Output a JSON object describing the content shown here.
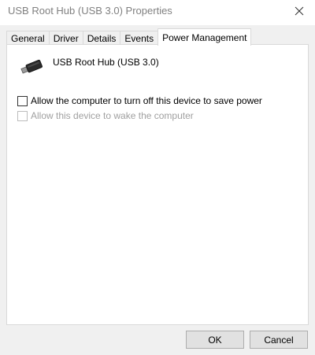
{
  "window": {
    "title": "USB Root Hub (USB 3.0) Properties"
  },
  "tabs": [
    {
      "label": "General",
      "active": false
    },
    {
      "label": "Driver",
      "active": false
    },
    {
      "label": "Details",
      "active": false
    },
    {
      "label": "Events",
      "active": false
    },
    {
      "label": "Power Management",
      "active": true
    }
  ],
  "device": {
    "name": "USB Root Hub (USB 3.0)",
    "icon": "usb-plug-icon"
  },
  "options": [
    {
      "label": "Allow the computer to turn off this device to save power",
      "checked": false,
      "enabled": true
    },
    {
      "label": "Allow this device to wake the computer",
      "checked": false,
      "enabled": false
    }
  ],
  "buttons": {
    "ok": "OK",
    "cancel": "Cancel"
  },
  "colors": {
    "dialog_bg": "#f0f0f0",
    "panel_bg": "#ffffff",
    "disabled_text": "#a0a0a0",
    "title_text": "#808080"
  }
}
